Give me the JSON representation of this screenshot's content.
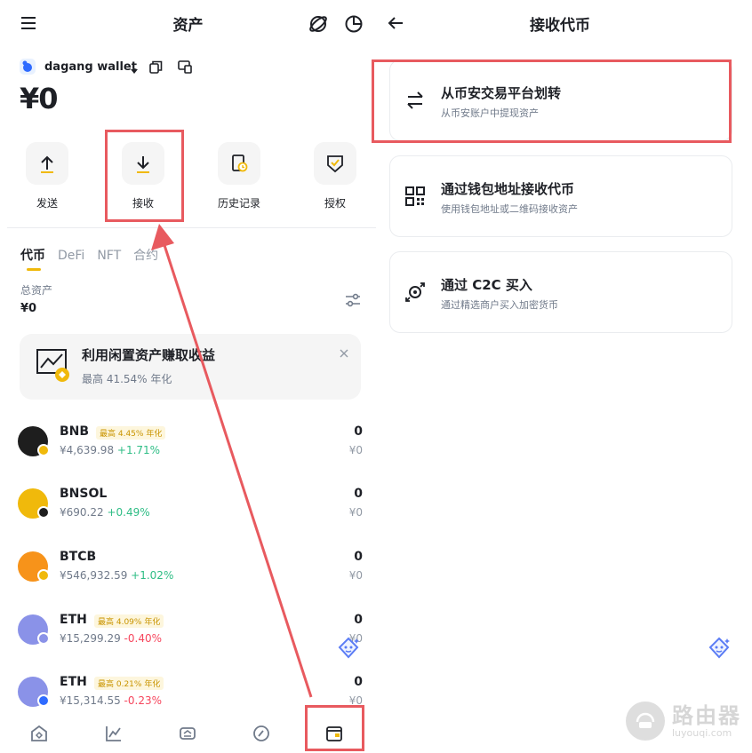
{
  "left": {
    "header": {
      "title": "资产",
      "menu_icon": "menu-icon",
      "globe_icon": "web3-globe-icon",
      "chart_icon": "pie-chart-icon"
    },
    "wallet": {
      "name": "dagang wallet",
      "balance": "¥0"
    },
    "actions": [
      {
        "label": "发送",
        "icon": "arrow-up-icon"
      },
      {
        "label": "接收",
        "icon": "arrow-down-icon"
      },
      {
        "label": "历史记录",
        "icon": "history-icon"
      },
      {
        "label": "授权",
        "icon": "shield-check-icon"
      }
    ],
    "tabs": [
      {
        "label": "代币",
        "active": true
      },
      {
        "label": "DeFi",
        "active": false
      },
      {
        "label": "NFT",
        "active": false
      },
      {
        "label": "合约",
        "active": false
      }
    ],
    "total": {
      "label": "总资产",
      "value": "¥0"
    },
    "promo": {
      "title": "利用闲置资产赚取收益",
      "subtitle": "最高 41.54% 年化"
    },
    "assets": [
      {
        "symbol": "BNB",
        "badge": "最高 4.45% 年化",
        "price": "¥4,639.98",
        "change": "+1.71%",
        "dir": "up",
        "qty": "0",
        "fiat": "¥0",
        "color": "#1e1e1e",
        "sub_color": "#f0b90b"
      },
      {
        "symbol": "BNSOL",
        "badge": "",
        "price": "¥690.22",
        "change": "+0.49%",
        "dir": "up",
        "qty": "0",
        "fiat": "¥0",
        "color": "#f0b90b",
        "sub_color": "#1e1e1e"
      },
      {
        "symbol": "BTCB",
        "badge": "",
        "price": "¥546,932.59",
        "change": "+1.02%",
        "dir": "up",
        "qty": "0",
        "fiat": "¥0",
        "color": "#f7931a",
        "sub_color": "#f0b90b"
      },
      {
        "symbol": "ETH",
        "badge": "最高 4.09% 年化",
        "price": "¥15,299.29",
        "change": "-0.40%",
        "dir": "down",
        "qty": "0",
        "fiat": "¥0",
        "color": "#8a92e8",
        "sub_color": "#8a92e8"
      },
      {
        "symbol": "ETH",
        "badge": "最高 0.21% 年化",
        "price": "¥15,314.55",
        "change": "-0.23%",
        "dir": "down",
        "qty": "0",
        "fiat": "¥0",
        "color": "#8a92e8",
        "sub_color": "#2f6bff"
      }
    ],
    "nav": [
      "home-icon",
      "markets-icon",
      "swap-icon",
      "earn-icon",
      "wallet-icon"
    ]
  },
  "right": {
    "header": {
      "title": "接收代币",
      "back_icon": "back-arrow-icon"
    },
    "options": [
      {
        "title": "从币安交易平台划转",
        "subtitle": "从币安账户中提现资产",
        "icon": "transfer-arrows-icon"
      },
      {
        "title": "通过钱包地址接收代币",
        "subtitle": "使用钱包地址或二维码接收资产",
        "icon": "qr-code-icon"
      },
      {
        "title": "通过 C2C 买入",
        "subtitle": "通过精选商户买入加密货币",
        "icon": "c2c-icon"
      }
    ]
  },
  "watermark": {
    "name": "路由器",
    "domain": "luyouqi.com"
  },
  "colors": {
    "accent": "#f0b90b",
    "highlight": "#e85a5f",
    "up": "#2ebd85",
    "down": "#f6465d"
  }
}
